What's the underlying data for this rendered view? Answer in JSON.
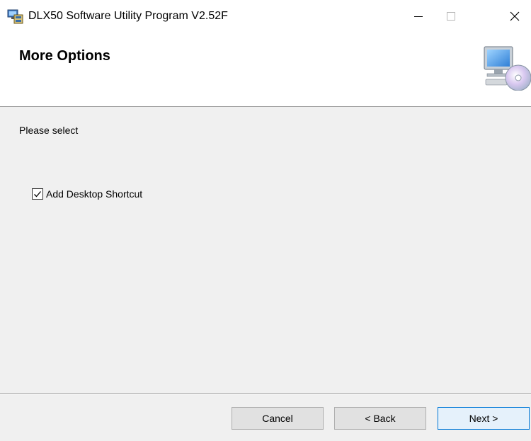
{
  "window": {
    "title": "DLX50 Software Utility Program V2.52F"
  },
  "banner": {
    "title": "More Options",
    "art_icon": "computer-with-disc-icon"
  },
  "body": {
    "prompt": "Please select",
    "shortcut_option": {
      "label": "Add Desktop Shortcut",
      "checked": true
    }
  },
  "footer": {
    "cancel_label": "Cancel",
    "back_label": "< Back",
    "next_label": "Next >"
  },
  "colors": {
    "dialog_bg": "#f0f0f0",
    "banner_bg": "#ffffff",
    "default_button_border": "#0078d7",
    "button_bg": "#e1e1e1"
  }
}
